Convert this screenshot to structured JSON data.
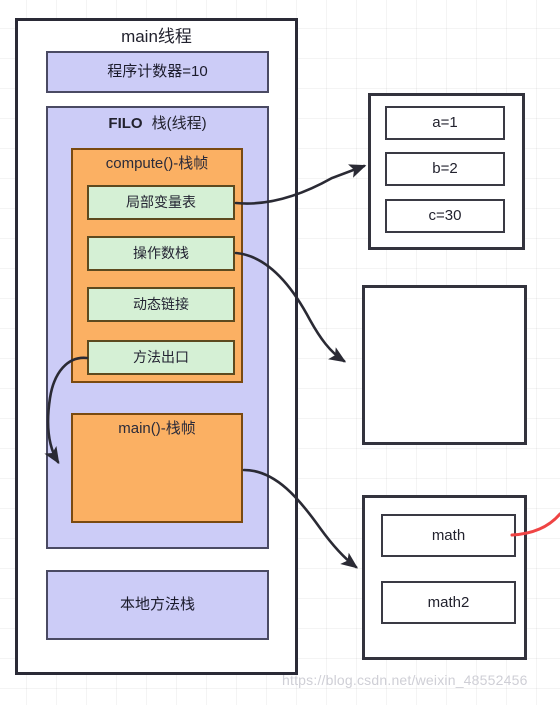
{
  "diagram": {
    "title": "main线程",
    "background": {
      "grid": true,
      "grid_spacing_px": 30,
      "color": "#ffffff"
    },
    "colors": {
      "lavender": "#ccccf7",
      "orange": "#fbb063",
      "green": "#d5f0d5",
      "outline_dark": "#2a2a36",
      "red_edge": "#ef4444"
    }
  },
  "thread": {
    "label": "main线程",
    "program_counter": {
      "label": "程序计数器=10"
    },
    "stack": {
      "mode_label": "FILO",
      "title": "栈(线程)",
      "frames": [
        {
          "name": "compute()-栈帧",
          "slots": [
            {
              "label": "局部变量表"
            },
            {
              "label": "操作数栈"
            },
            {
              "label": "动态链接"
            },
            {
              "label": "方法出口"
            }
          ]
        },
        {
          "name": "main()-栈帧",
          "slots": []
        }
      ]
    },
    "native_method_stack": {
      "label": "本地方法栈"
    }
  },
  "heap_boxes": [
    {
      "name": "local-variable-table-target",
      "entries": [
        {
          "label": "a=1"
        },
        {
          "label": "b=2"
        },
        {
          "label": "c=30"
        }
      ]
    },
    {
      "name": "operand-stack-target",
      "entries": []
    },
    {
      "name": "method-area-target",
      "entries": [
        {
          "label": "math"
        },
        {
          "label": "math2"
        }
      ]
    }
  ],
  "connections": [
    {
      "from": "局部变量表",
      "to": "a=1 / b=2 / c=30 box",
      "style": "solid-arrow"
    },
    {
      "from": "操作数栈",
      "to": "empty box",
      "style": "solid-arrow"
    },
    {
      "from": "方法出口",
      "to": "main()-栈帧",
      "style": "solid-arrow"
    },
    {
      "from": "main()-栈帧",
      "to": "math / math2 box",
      "style": "solid-arrow"
    },
    {
      "from": "math",
      "to": "off-screen right",
      "style": "red-curve"
    }
  ],
  "watermark": {
    "text": "https://blog.csdn.net/weixin_48552456"
  }
}
